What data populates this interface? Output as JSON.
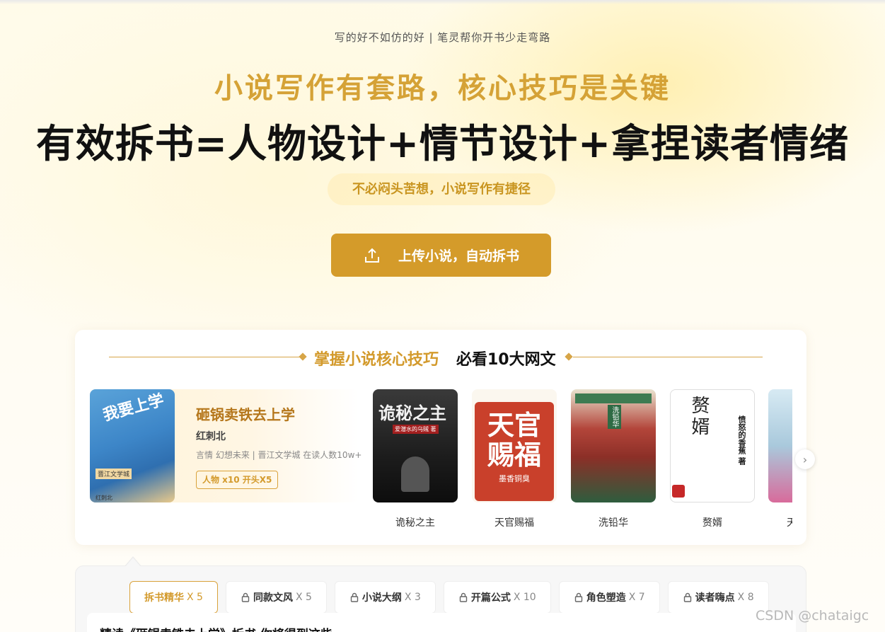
{
  "hero": {
    "tagline": "写的好不如仿的好 | 笔灵帮你开书少走弯路",
    "headline": "小说写作有套路，核心技巧是关键",
    "formula": "有效拆书=人物设计+情节设计+拿捏读者情绪",
    "pill": "不必闷头苦想，小说写作有捷径",
    "upload_label": "上传小说，自动拆书"
  },
  "section": {
    "title_accent": "掌握小说核心技巧",
    "title_main": "必看10大网文"
  },
  "featured": {
    "cover_title": "我要上学",
    "cover_badge": "晋江文学城",
    "cover_author": "红刺北",
    "title": "砸锅卖铁去上学",
    "author": "红刺北",
    "meta": "言情 幻想未来 | 晋江文学城 在读人数10w+",
    "tag": "人物 x10 开头X5"
  },
  "books": [
    {
      "name": "诡秘之主",
      "cover_text": "诡秘之主",
      "cover_sub": "爱潜水的乌贼 著"
    },
    {
      "name": "天官赐福",
      "cover_text": "天官赐福",
      "cover_sub": "墨香铜臭"
    },
    {
      "name": "洗铅华",
      "cover_text": "洗铅华",
      "cover_sub": ""
    },
    {
      "name": "赘婿",
      "cover_text": "赘婿",
      "cover_sub": "愤怒的香蕉 著"
    },
    {
      "name": "天",
      "cover_text": "",
      "cover_sub": ""
    }
  ],
  "tabs": [
    {
      "label": "拆书精华",
      "count": "X 5",
      "locked": false
    },
    {
      "label": "同款文风",
      "count": "X 5",
      "locked": true
    },
    {
      "label": "小说大纲",
      "count": "X 3",
      "locked": true
    },
    {
      "label": "开篇公式",
      "count": "X 10",
      "locked": true
    },
    {
      "label": "角色塑造",
      "count": "X 7",
      "locked": true
    },
    {
      "label": "读者嗨点",
      "count": "X 8",
      "locked": true
    }
  ],
  "panel_heading": "精读《砸锅卖铁去上学》拆书 你将得到这些",
  "watermark": "CSDN @chataigc",
  "colors": {
    "accent": "#d49b2a",
    "accent_text": "#d39a2c"
  }
}
